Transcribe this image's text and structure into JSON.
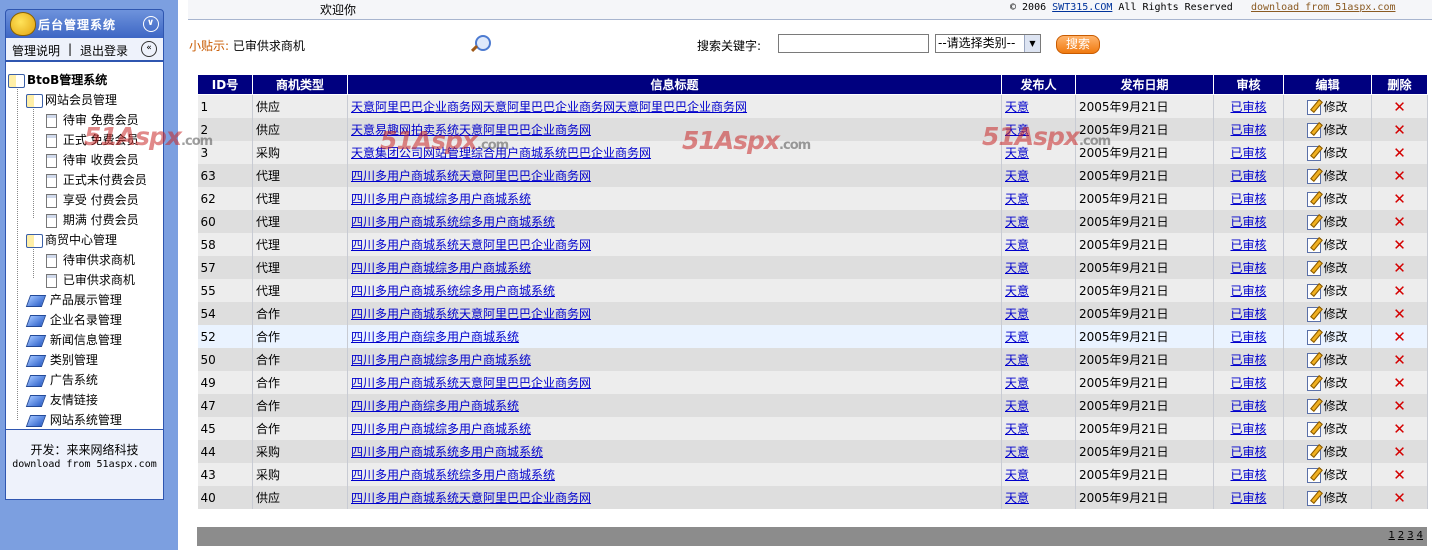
{
  "sidebar": {
    "title": "后台管理系统",
    "toolbar": {
      "help": "管理说明",
      "sep": "|",
      "logout": "退出登录"
    },
    "tree": {
      "root": "BtoB管理系统",
      "groups": [
        {
          "label": "网站会员管理",
          "items": [
            "待审 免费会员",
            "正式 免费会员",
            "待审 收费会员",
            "正式未付费会员",
            "享受 付费会员",
            "期满 付费会员"
          ]
        },
        {
          "label": "商贸中心管理",
          "items": [
            "待审供求商机",
            "已审供求商机"
          ]
        }
      ],
      "modules": [
        "产品展示管理",
        "企业名录管理",
        "新闻信息管理",
        "类别管理",
        "广告系统",
        "友情链接",
        "网站系统管理"
      ]
    },
    "footer": {
      "line1": "开发：来来网络科技",
      "line2": "download from 51aspx.com"
    }
  },
  "topbar": {
    "welcome": "欢迎你",
    "copyright_prefix": "© 2006",
    "copyright_link": "SWT315.COM",
    "copyright_suffix": "All Rights Reserved",
    "download_link": "download from 51aspx.com"
  },
  "tip": {
    "label": "小贴示:",
    "text": "已审供求商机"
  },
  "search": {
    "label": "搜索关键字:",
    "value": "",
    "placeholder": "",
    "category_selected": "--请选择类别--",
    "button": "搜索"
  },
  "table": {
    "columns": [
      "ID号",
      "商机类型",
      "信息标题",
      "发布人",
      "发布日期",
      "审核",
      "编辑",
      "删除"
    ],
    "edit_label": "修改",
    "rows": [
      {
        "id": "1",
        "type": "供应",
        "title": "天意阿里巴巴企业商务网天意阿里巴巴企业商务网天意阿里巴巴企业商务网",
        "publisher": "天意",
        "date": "2005年9月21日",
        "status": "已审核"
      },
      {
        "id": "2",
        "type": "供应",
        "title": "天意易趣网拍卖系统天意阿里巴巴企业商务网",
        "publisher": "天意",
        "date": "2005年9月21日",
        "status": "已审核"
      },
      {
        "id": "3",
        "type": "采购",
        "title": "天意集团公司网站管理综合用户商城系统巴巴企业商务网",
        "publisher": "天意",
        "date": "2005年9月21日",
        "status": "已审核"
      },
      {
        "id": "63",
        "type": "代理",
        "title": "四川多用户商城系统天意阿里巴巴企业商务网",
        "publisher": "天意",
        "date": "2005年9月21日",
        "status": "已审核"
      },
      {
        "id": "62",
        "type": "代理",
        "title": "四川多用户商城综多用户商城系统",
        "publisher": "天意",
        "date": "2005年9月21日",
        "status": "已审核"
      },
      {
        "id": "60",
        "type": "代理",
        "title": "四川多用户商城系统综多用户商城系统",
        "publisher": "天意",
        "date": "2005年9月21日",
        "status": "已审核"
      },
      {
        "id": "58",
        "type": "代理",
        "title": "四川多用户商城系统天意阿里巴巴企业商务网",
        "publisher": "天意",
        "date": "2005年9月21日",
        "status": "已审核"
      },
      {
        "id": "57",
        "type": "代理",
        "title": "四川多用户商城综多用户商城系统",
        "publisher": "天意",
        "date": "2005年9月21日",
        "status": "已审核"
      },
      {
        "id": "55",
        "type": "代理",
        "title": "四川多用户商城系统综多用户商城系统",
        "publisher": "天意",
        "date": "2005年9月21日",
        "status": "已审核"
      },
      {
        "id": "54",
        "type": "合作",
        "title": "四川多用户商城系统天意阿里巴巴企业商务网",
        "publisher": "天意",
        "date": "2005年9月21日",
        "status": "已审核"
      },
      {
        "id": "52",
        "type": "合作",
        "title": "四川多用户商综多用户商城系统",
        "publisher": "天意",
        "date": "2005年9月21日",
        "status": "已审核"
      },
      {
        "id": "50",
        "type": "合作",
        "title": "四川多用户商城综多用户商城系统",
        "publisher": "天意",
        "date": "2005年9月21日",
        "status": "已审核"
      },
      {
        "id": "49",
        "type": "合作",
        "title": "四川多用户商城系统天意阿里巴巴企业商务网",
        "publisher": "天意",
        "date": "2005年9月21日",
        "status": "已审核"
      },
      {
        "id": "47",
        "type": "合作",
        "title": "四川多用户商综多用户商城系统",
        "publisher": "天意",
        "date": "2005年9月21日",
        "status": "已审核"
      },
      {
        "id": "45",
        "type": "合作",
        "title": "四川多用户商城综多用户商城系统",
        "publisher": "天意",
        "date": "2005年9月21日",
        "status": "已审核"
      },
      {
        "id": "44",
        "type": "采购",
        "title": "四川多用户商城系统多用户商城系统",
        "publisher": "天意",
        "date": "2005年9月21日",
        "status": "已审核"
      },
      {
        "id": "43",
        "type": "采购",
        "title": "四川多用户商城系统综多用户商城系统",
        "publisher": "天意",
        "date": "2005年9月21日",
        "status": "已审核"
      },
      {
        "id": "40",
        "type": "供应",
        "title": "四川多用户商城系统天意阿里巴巴企业商务网",
        "publisher": "天意",
        "date": "2005年9月21日",
        "status": "已审核"
      }
    ]
  },
  "pager": [
    "1",
    "2",
    "3",
    "4"
  ],
  "watermark": {
    "brand": "51Aspx",
    "suffix": ".com"
  },
  "colors": {
    "header_bg": "#00007f",
    "sidebar_bg": "#7c9fe0",
    "link": "#0000cc",
    "delete": "#d40000",
    "tip_label": "#c85a00"
  }
}
